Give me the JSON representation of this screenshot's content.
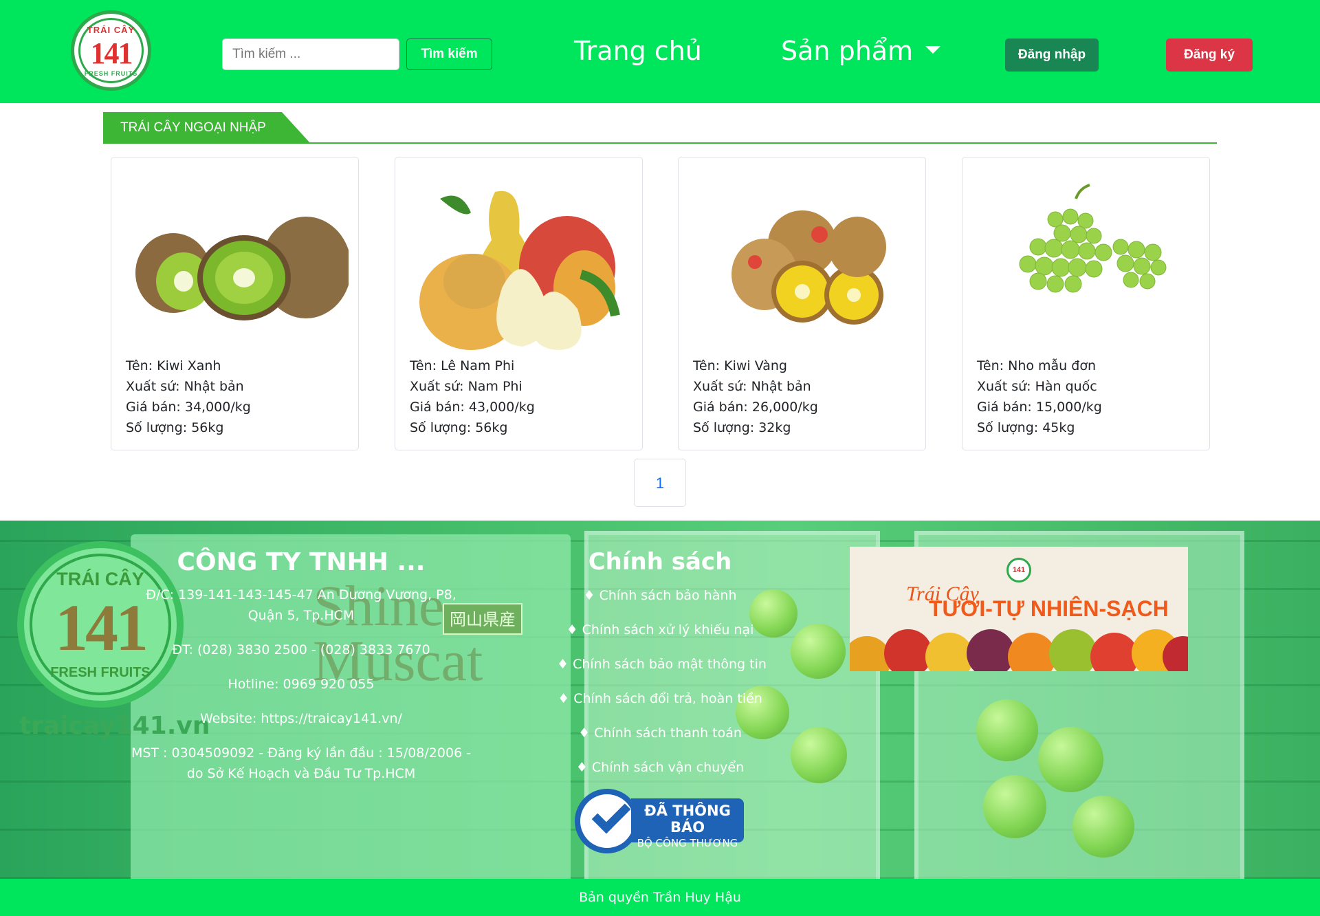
{
  "brand": {
    "logo_top": "TRÁI CÂY",
    "logo_number": "141",
    "logo_bottom": "FRESH FRUITS",
    "colors": {
      "navbar": "#00e65c",
      "login": "#198754",
      "register": "#dc3545",
      "section": "#3db535"
    }
  },
  "header": {
    "search_placeholder": "Tìm kiếm ...",
    "search_button": "Tìm kiếm",
    "nav_home": "Trang chủ",
    "nav_products": "Sản phẩm",
    "login": "Đăng nhập",
    "register": "Đăng ký"
  },
  "section": {
    "title": "TRÁI CÂY NGOẠI NHẬP"
  },
  "products": [
    {
      "name": "Tên: Kiwi Xanh",
      "origin": "Xuất sứ: Nhật bản",
      "price": "Giá bán: 34,000/kg",
      "qty": "Số lượng: 56kg",
      "image": "kiwi-green"
    },
    {
      "name": "Tên: Lê Nam Phi",
      "origin": "Xuất sứ: Nam Phi",
      "price": "Giá bán: 43,000/kg",
      "qty": "Số lượng: 56kg",
      "image": "pear"
    },
    {
      "name": "Tên: Kiwi Vàng",
      "origin": "Xuất sứ: Nhật bản",
      "price": "Giá bán: 26,000/kg",
      "qty": "Số lượng: 32kg",
      "image": "kiwi-gold"
    },
    {
      "name": "Tên: Nho mẫu đơn",
      "origin": "Xuất sứ: Hàn quốc",
      "price": "Giá bán: 15,000/kg",
      "qty": "Số lượng: 45kg",
      "image": "grapes"
    }
  ],
  "pagination": {
    "current": "1"
  },
  "footer": {
    "website_mark": "traicay141.vn",
    "shine_text": "Shine\nMuscat",
    "shine_jp": "岡山県産",
    "company": {
      "title": "CÔNG TY TNHH ...",
      "address": "Đ/C: 139-141-143-145-47 An Dương Vương, P8, Quận 5, Tp.HCM",
      "phone": "ĐT: (028) 3830 2500 - (028) 3833 7670",
      "hotline": "Hotline: 0969 920 055",
      "website": "Website: https://traicay141.vn/",
      "tax": "MST : 0304509092 - Đăng ký lần đầu : 15/08/2006 - do Sở Kế Hoạch và Đầu Tư Tp.HCM"
    },
    "policy": {
      "title": "Chính sách",
      "items": [
        "♦ Chính sách bảo hành",
        "♦ Chính sách xử lý khiếu nại",
        "♦ Chính sách bảo mật thông tin",
        "♦ Chính sách đổi trả, hoàn tiền",
        "♦ Chính sách thanh toán",
        "♦ Chính sách vận chuyển"
      ]
    },
    "banner": {
      "line1": "Trái Cây",
      "line2": "TƯƠI-TỰ NHIÊN-SẠCH",
      "logo": "141"
    },
    "badge": {
      "line1": "ĐÃ THÔNG BÁO",
      "line2": "BỘ CÔNG THƯƠNG"
    },
    "copyright": "Bản quyền Trần Huy Hậu"
  }
}
